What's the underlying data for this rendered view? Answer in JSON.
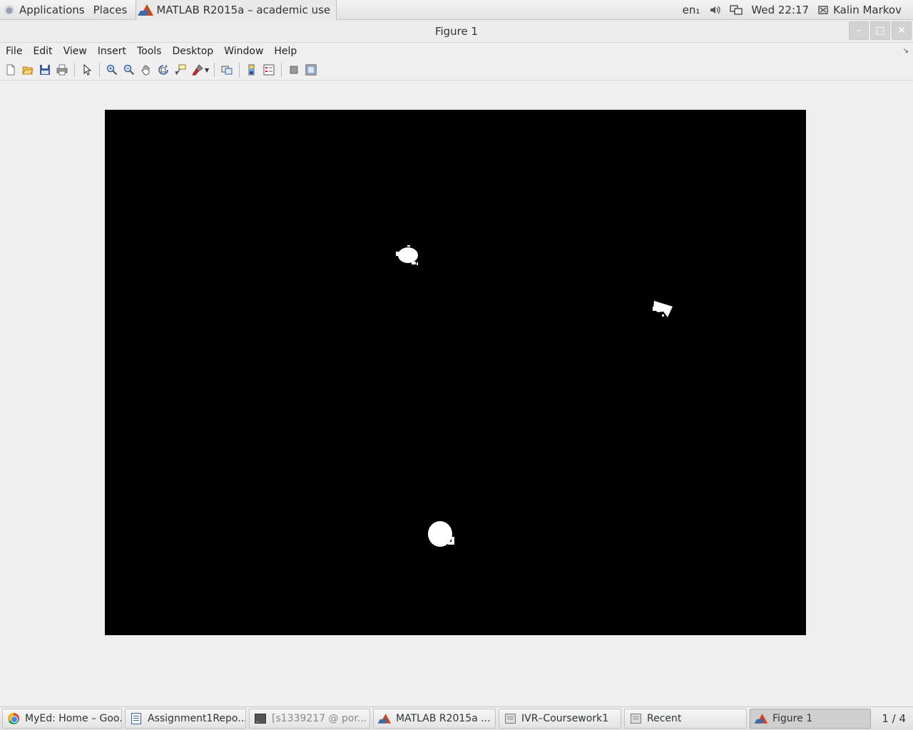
{
  "top_panel": {
    "applications_label": "Applications",
    "places_label": "Places",
    "active_app_label": "MATLAB R2015a – academic use",
    "keyboard_layout": "en₁",
    "clock": "Wed 22:17",
    "user_name": "Kalin Markov"
  },
  "window": {
    "title": "Figure 1"
  },
  "menubar": {
    "items": [
      "File",
      "Edit",
      "View",
      "Insert",
      "Tools",
      "Desktop",
      "Window",
      "Help"
    ]
  },
  "toolbar": {
    "icons": [
      "new-figure-icon",
      "open-file-icon",
      "save-figure-icon",
      "print-figure-icon",
      "edit-plot-icon",
      "zoom-in-icon",
      "zoom-out-icon",
      "pan-icon",
      "rotate-3d-icon",
      "data-cursor-icon",
      "brush-icon",
      "link-plot-icon",
      "insert-colorbar-icon",
      "insert-legend-icon",
      "hide-plot-tools-icon",
      "show-plot-tools-icon"
    ]
  },
  "figure": {
    "image_background": "#000000",
    "blob_color": "#ffffff",
    "blob_count": 3
  },
  "taskbar": {
    "tasks": [
      {
        "label": "MyEd: Home – Goo...",
        "icon": "chrome-icon"
      },
      {
        "label": "Assignment1Repo...",
        "icon": "document-icon"
      },
      {
        "label": "[s1339217 @ por...",
        "icon": "terminal-icon"
      },
      {
        "label": "MATLAB R2015a ...",
        "icon": "matlab-icon"
      },
      {
        "label": "IVR–Coursework1",
        "icon": "folder-icon"
      },
      {
        "label": "Recent",
        "icon": "folder-icon"
      },
      {
        "label": "Figure 1",
        "icon": "matlab-icon"
      }
    ],
    "workspace_indicator": "1 / 4"
  }
}
